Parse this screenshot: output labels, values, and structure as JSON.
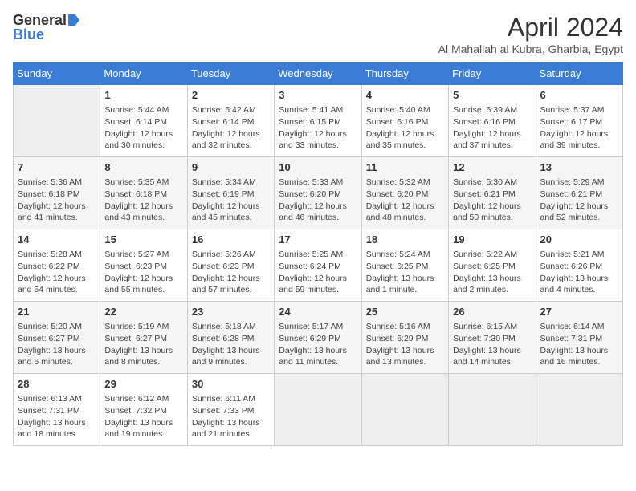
{
  "header": {
    "logo_general": "General",
    "logo_blue": "Blue",
    "month_title": "April 2024",
    "subtitle": "Al Mahallah al Kubra, Gharbia, Egypt"
  },
  "days_of_week": [
    "Sunday",
    "Monday",
    "Tuesday",
    "Wednesday",
    "Thursday",
    "Friday",
    "Saturday"
  ],
  "weeks": [
    [
      {
        "day": "",
        "info": ""
      },
      {
        "day": "1",
        "info": "Sunrise: 5:44 AM\nSunset: 6:14 PM\nDaylight: 12 hours\nand 30 minutes."
      },
      {
        "day": "2",
        "info": "Sunrise: 5:42 AM\nSunset: 6:14 PM\nDaylight: 12 hours\nand 32 minutes."
      },
      {
        "day": "3",
        "info": "Sunrise: 5:41 AM\nSunset: 6:15 PM\nDaylight: 12 hours\nand 33 minutes."
      },
      {
        "day": "4",
        "info": "Sunrise: 5:40 AM\nSunset: 6:16 PM\nDaylight: 12 hours\nand 35 minutes."
      },
      {
        "day": "5",
        "info": "Sunrise: 5:39 AM\nSunset: 6:16 PM\nDaylight: 12 hours\nand 37 minutes."
      },
      {
        "day": "6",
        "info": "Sunrise: 5:37 AM\nSunset: 6:17 PM\nDaylight: 12 hours\nand 39 minutes."
      }
    ],
    [
      {
        "day": "7",
        "info": "Sunrise: 5:36 AM\nSunset: 6:18 PM\nDaylight: 12 hours\nand 41 minutes."
      },
      {
        "day": "8",
        "info": "Sunrise: 5:35 AM\nSunset: 6:18 PM\nDaylight: 12 hours\nand 43 minutes."
      },
      {
        "day": "9",
        "info": "Sunrise: 5:34 AM\nSunset: 6:19 PM\nDaylight: 12 hours\nand 45 minutes."
      },
      {
        "day": "10",
        "info": "Sunrise: 5:33 AM\nSunset: 6:20 PM\nDaylight: 12 hours\nand 46 minutes."
      },
      {
        "day": "11",
        "info": "Sunrise: 5:32 AM\nSunset: 6:20 PM\nDaylight: 12 hours\nand 48 minutes."
      },
      {
        "day": "12",
        "info": "Sunrise: 5:30 AM\nSunset: 6:21 PM\nDaylight: 12 hours\nand 50 minutes."
      },
      {
        "day": "13",
        "info": "Sunrise: 5:29 AM\nSunset: 6:21 PM\nDaylight: 12 hours\nand 52 minutes."
      }
    ],
    [
      {
        "day": "14",
        "info": "Sunrise: 5:28 AM\nSunset: 6:22 PM\nDaylight: 12 hours\nand 54 minutes."
      },
      {
        "day": "15",
        "info": "Sunrise: 5:27 AM\nSunset: 6:23 PM\nDaylight: 12 hours\nand 55 minutes."
      },
      {
        "day": "16",
        "info": "Sunrise: 5:26 AM\nSunset: 6:23 PM\nDaylight: 12 hours\nand 57 minutes."
      },
      {
        "day": "17",
        "info": "Sunrise: 5:25 AM\nSunset: 6:24 PM\nDaylight: 12 hours\nand 59 minutes."
      },
      {
        "day": "18",
        "info": "Sunrise: 5:24 AM\nSunset: 6:25 PM\nDaylight: 13 hours\nand 1 minute."
      },
      {
        "day": "19",
        "info": "Sunrise: 5:22 AM\nSunset: 6:25 PM\nDaylight: 13 hours\nand 2 minutes."
      },
      {
        "day": "20",
        "info": "Sunrise: 5:21 AM\nSunset: 6:26 PM\nDaylight: 13 hours\nand 4 minutes."
      }
    ],
    [
      {
        "day": "21",
        "info": "Sunrise: 5:20 AM\nSunset: 6:27 PM\nDaylight: 13 hours\nand 6 minutes."
      },
      {
        "day": "22",
        "info": "Sunrise: 5:19 AM\nSunset: 6:27 PM\nDaylight: 13 hours\nand 8 minutes."
      },
      {
        "day": "23",
        "info": "Sunrise: 5:18 AM\nSunset: 6:28 PM\nDaylight: 13 hours\nand 9 minutes."
      },
      {
        "day": "24",
        "info": "Sunrise: 5:17 AM\nSunset: 6:29 PM\nDaylight: 13 hours\nand 11 minutes."
      },
      {
        "day": "25",
        "info": "Sunrise: 5:16 AM\nSunset: 6:29 PM\nDaylight: 13 hours\nand 13 minutes."
      },
      {
        "day": "26",
        "info": "Sunrise: 6:15 AM\nSunset: 7:30 PM\nDaylight: 13 hours\nand 14 minutes."
      },
      {
        "day": "27",
        "info": "Sunrise: 6:14 AM\nSunset: 7:31 PM\nDaylight: 13 hours\nand 16 minutes."
      }
    ],
    [
      {
        "day": "28",
        "info": "Sunrise: 6:13 AM\nSunset: 7:31 PM\nDaylight: 13 hours\nand 18 minutes."
      },
      {
        "day": "29",
        "info": "Sunrise: 6:12 AM\nSunset: 7:32 PM\nDaylight: 13 hours\nand 19 minutes."
      },
      {
        "day": "30",
        "info": "Sunrise: 6:11 AM\nSunset: 7:33 PM\nDaylight: 13 hours\nand 21 minutes."
      },
      {
        "day": "",
        "info": ""
      },
      {
        "day": "",
        "info": ""
      },
      {
        "day": "",
        "info": ""
      },
      {
        "day": "",
        "info": ""
      }
    ]
  ]
}
